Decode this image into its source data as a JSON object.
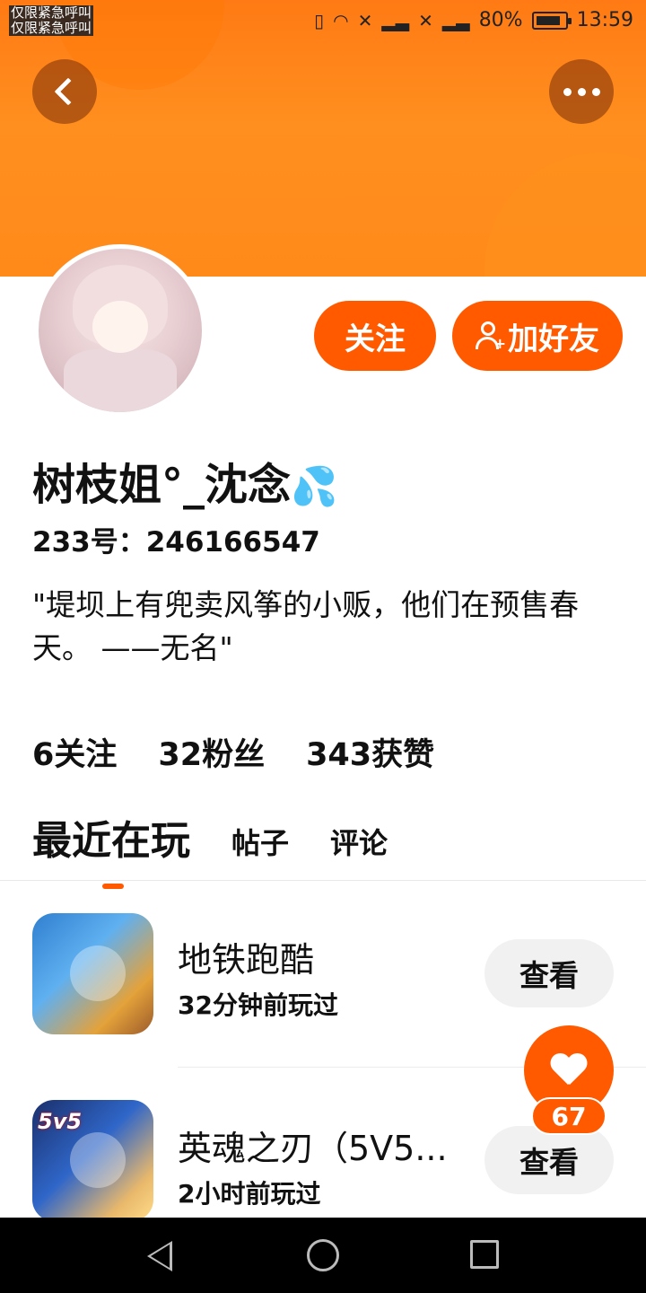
{
  "status_bar": {
    "carrier_lines": [
      "仅限紧急呼叫",
      "仅限紧急呼叫"
    ],
    "battery": "80%",
    "time": "13:59"
  },
  "header": {
    "back_icon": "chevron-left-icon",
    "more_icon": "more-dots-icon"
  },
  "profile": {
    "name": "树枝姐°_沈念",
    "name_emoji": "💦",
    "id_line": "233号：246166547",
    "bio": "\"堤坝上有兜卖风筝的小贩，他们在预售春天。 ——无名\"",
    "follow_label": "关注",
    "add_friend_label": "加好友"
  },
  "stats": {
    "following": "6关注",
    "followers": "32粉丝",
    "likes": "343获赞"
  },
  "tabs": {
    "recent": "最近在玩",
    "posts": "帖子",
    "comments": "评论"
  },
  "games": [
    {
      "title": "地铁跑酷",
      "subtitle": "32分钟前玩过",
      "button": "查看"
    },
    {
      "title": "英魂之刃（5V5...",
      "subtitle": "2小时前玩过",
      "button": "查看",
      "badge": "5v5"
    }
  ],
  "like_fab": {
    "count": "67"
  },
  "colors": {
    "accent": "#ff5a00",
    "banner": "#ff8a1a"
  }
}
